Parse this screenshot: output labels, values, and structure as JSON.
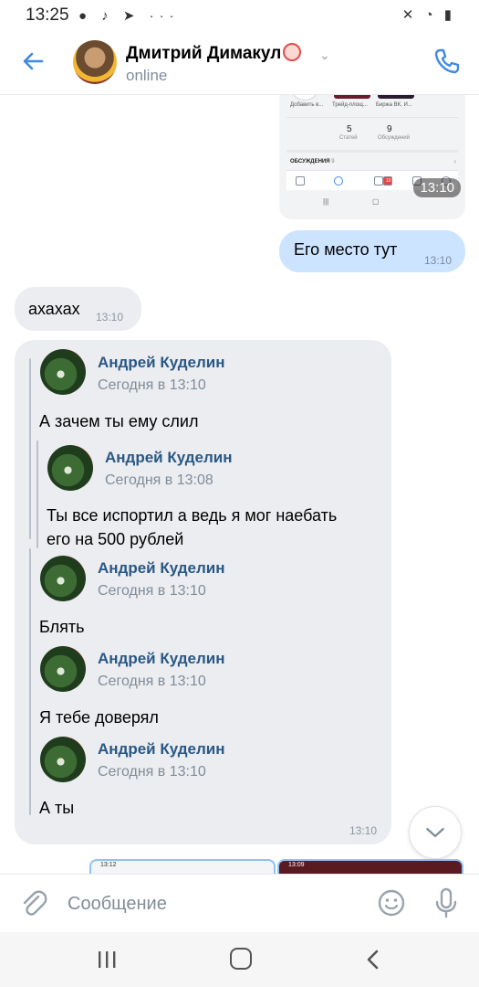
{
  "status_bar": {
    "time": "13:25",
    "left_icons": "● ♪ ➤ ···",
    "right_icons": "✕ ◔ ▮"
  },
  "header": {
    "back_icon": "arrow-left-icon",
    "contact_name": "Дмитрий Димакул",
    "status": "online",
    "call_icon": "phone-icon",
    "accent": "#3f8ae0"
  },
  "screenshot_top": {
    "tile_labels": [
      "Добавить в...",
      "Трейд-площ...",
      "Биржа ВК, И..."
    ],
    "stat1_value": "5",
    "stat1_label": "Статей",
    "stat2_value": "9",
    "stat2_label": "Обсуждений",
    "discussions_label": "ОБСУЖДЕНИЯ",
    "discussions_count": "9",
    "badge": "10",
    "time": "13:10"
  },
  "messages": {
    "outgoing_1": {
      "text": "Его место тут",
      "time": "13:10"
    },
    "incoming_1": {
      "text": "ахахах",
      "time": "13:10"
    },
    "incoming_2": {
      "time": "13:10",
      "forwards": [
        {
          "name": "Андрей Куделин",
          "date": "Сегодня в 13:10",
          "text": "А зачем ты ему слил"
        },
        {
          "name": "Андрей Куделин",
          "date": "Сегодня в 13:08",
          "text": "Ты все испортил а ведь я мог наебать его на 500 рублей"
        },
        {
          "name": "Андрей Куделин",
          "date": "Сегодня в 13:10",
          "text": "Блять"
        },
        {
          "name": "Андрей Куделин",
          "date": "Сегодня в 13:10",
          "text": "Я тебе доверял"
        },
        {
          "name": "Андрей Куделин",
          "date": "Сегодня в 13:10",
          "text": "А ты"
        }
      ]
    }
  },
  "bottom_peek": {
    "left_time": "13:12",
    "right_time": "13:09"
  },
  "composer": {
    "placeholder": "Сообщение",
    "attach_icon": "paperclip-icon",
    "emoji_icon": "smile-icon",
    "mic_icon": "microphone-icon"
  },
  "system_nav": {
    "recent_icon": "recent-apps-icon",
    "home_icon": "home-icon",
    "back_icon": "back-chevron-icon"
  }
}
